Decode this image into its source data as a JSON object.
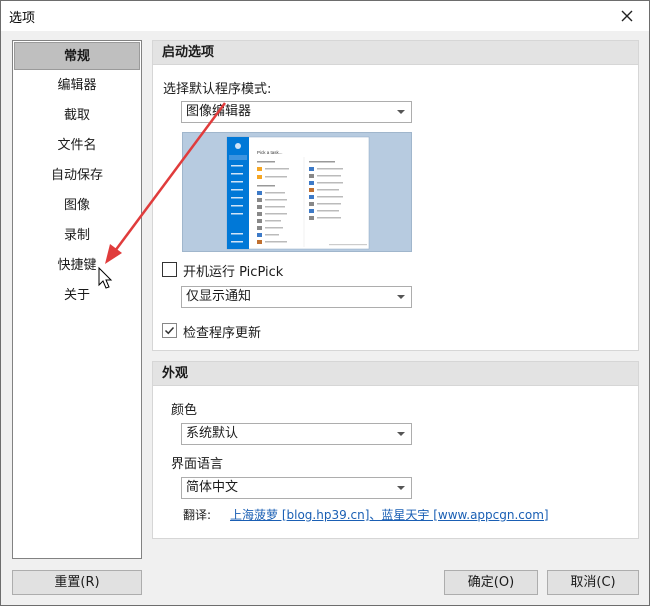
{
  "window": {
    "title": "选项"
  },
  "sidebar": {
    "items": [
      {
        "label": "常规"
      },
      {
        "label": "编辑器"
      },
      {
        "label": "截取"
      },
      {
        "label": "文件名"
      },
      {
        "label": "自动保存"
      },
      {
        "label": "图像"
      },
      {
        "label": "录制"
      },
      {
        "label": "快捷键"
      },
      {
        "label": "关于"
      }
    ],
    "selected": "常规"
  },
  "startup": {
    "header": "启动选项",
    "mode_label": "选择默认程序模式:",
    "mode_value": "图像编辑器",
    "run_at_startup_label": "开机运行 PicPick",
    "run_at_startup_checked": false,
    "notify_value": "仅显示通知",
    "check_updates_label": "检查程序更新",
    "check_updates_checked": true
  },
  "appearance": {
    "header": "外观",
    "color_label": "颜色",
    "color_value": "系统默认",
    "language_label": "界面语言",
    "language_value": "简体中文",
    "translation_label": "翻译:",
    "translation_link": "上海菠萝 [blog.hp39.cn]、蓝星天宇 [www.appcgn.com]"
  },
  "preview": {
    "heading": "Pick a task..."
  },
  "buttons": {
    "reset": "重置(R)",
    "ok": "确定(O)",
    "cancel": "取消(C)"
  },
  "colors": {
    "selected_bg": "#bfbfbf",
    "accent": "#0078d7",
    "annotation_arrow": "#e03c3c",
    "link": "#1a5fb4"
  }
}
